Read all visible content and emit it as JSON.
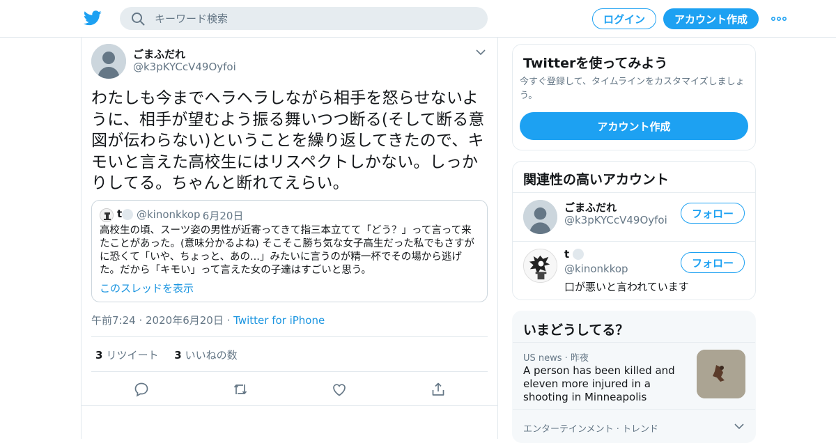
{
  "header": {
    "search_placeholder": "キーワード検索",
    "login_label": "ログイン",
    "signup_label": "アカウント作成",
    "brand_color": "#1da1f2"
  },
  "tweet": {
    "author_name": "ごまふだれ",
    "author_handle": "@k3pKYCcV49Oyfoi",
    "text": "わたしも今までヘラヘラしながら相手を怒らせないように、相手が望むよう振る舞いつつ断る(そして断る意図が伝わらない)ということを繰り返してきたので、キモいと言えた高校生にはリスペクトしかない。しっかりしてる。ちゃんと断れてえらい。",
    "quote": {
      "name": "t",
      "handle": "@kinonkkop",
      "date": "6月20日",
      "text": "高校生の頃、スーツ姿の男性が近寄ってきて指三本立てて「どう？」って言って来たことがあった。(意味分かるよね) そこそこ勝ち気な女子高生だった私でもさすがに恐くて「いや、ちょっと、あの...」みたいに言うのが精一杯でその場から逃げた。だから「キモい」って言えた女の子達はすごいと思う。",
      "thread_link": "このスレッドを表示"
    },
    "time": "午前7:24",
    "date": "2020年6月20日",
    "source": "Twitter for iPhone",
    "retweet_count": "3",
    "retweet_label": "リツイート",
    "like_count": "3",
    "like_label": "いいねの数"
  },
  "sidebar": {
    "signup_card": {
      "title": "Twitterを使ってみよう",
      "subtitle": "今すぐ登録して、タイムラインをカスタマイズしましょう。",
      "button": "アカウント作成"
    },
    "related": {
      "title": "関連性の高いアカウント",
      "accounts": [
        {
          "name": "ごまふだれ",
          "handle": "@k3pKYCcV49Oyfoi",
          "bio": "",
          "follow": "フォロー"
        },
        {
          "name": "t",
          "handle": "@kinonkkop",
          "bio": "口が悪いと言われています",
          "follow": "フォロー"
        }
      ]
    },
    "trends": {
      "title": "いまどうしてる？",
      "items": [
        {
          "context": "US news",
          "time": "昨夜",
          "headline": "A person has been killed and eleven more injured in a shooting in Minneapolis"
        },
        {
          "context": "エンターテインメント · トレンド"
        }
      ]
    }
  }
}
